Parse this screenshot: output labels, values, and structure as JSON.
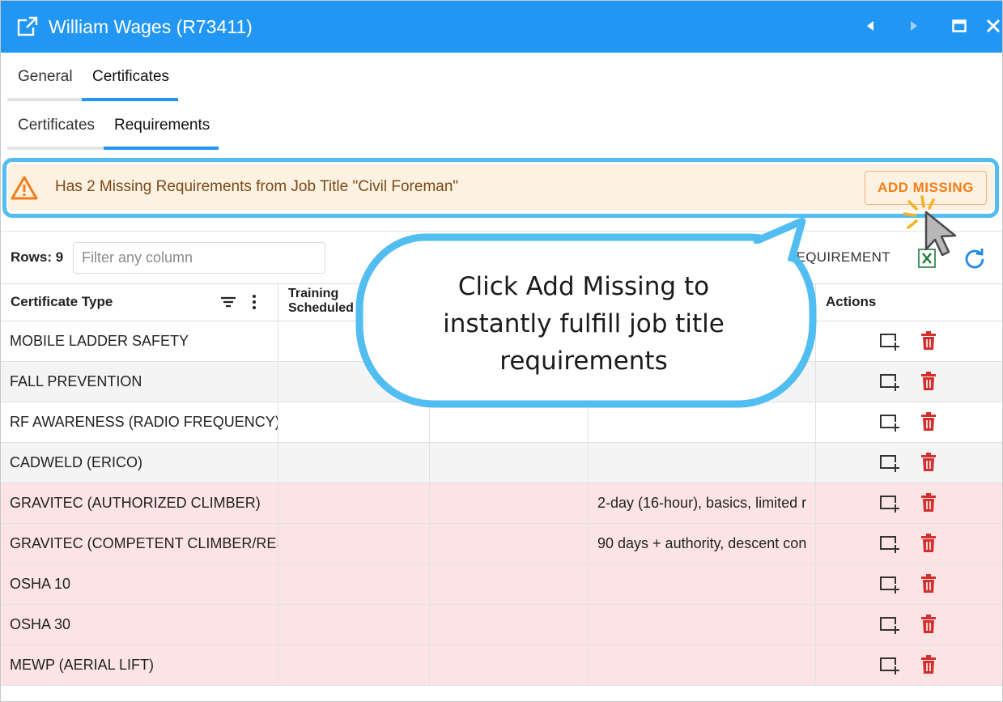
{
  "window": {
    "title": "William Wages (R73411)",
    "controls": [
      "prev-icon",
      "next-icon",
      "maximize-icon",
      "close-icon"
    ]
  },
  "tabs_primary": [
    {
      "label": "General",
      "active": false
    },
    {
      "label": "Certificates",
      "active": true
    }
  ],
  "tabs_secondary": [
    {
      "label": "Certificates",
      "active": false
    },
    {
      "label": "Requirements",
      "active": true
    }
  ],
  "warning": {
    "text": "Has 2 Missing Requirements from Job Title \"Civil Foreman\"",
    "button_label": "ADD MISSING",
    "color": "#ef7f1a"
  },
  "toolbar": {
    "rows_label": "Rows: 9",
    "filter_placeholder": "Filter any column",
    "add_requirement_label": "REQUIREMENT"
  },
  "grid": {
    "columns": [
      {
        "label": "Certificate Type"
      },
      {
        "label": "Training Scheduled"
      },
      {
        "label": ""
      },
      {
        "label": ""
      },
      {
        "label": "Actions"
      }
    ],
    "rows": [
      {
        "type": "MOBILE LADDER SAFETY",
        "notes": "",
        "status": "white"
      },
      {
        "type": "FALL PREVENTION",
        "notes": "",
        "status": "gray"
      },
      {
        "type": "RF AWARENESS (RADIO FREQUENCY)",
        "notes": "",
        "status": "white"
      },
      {
        "type": "CADWELD (ERICO)",
        "notes": "",
        "status": "gray"
      },
      {
        "type": "GRAVITEC (AUTHORIZED CLIMBER)",
        "notes": "2-day (16-hour), basics, limited r",
        "status": "red"
      },
      {
        "type": "GRAVITEC (COMPETENT CLIMBER/RESCUE)",
        "notes": "90 days + authority, descent con",
        "status": "red"
      },
      {
        "type": "OSHA 10",
        "notes": "",
        "status": "red"
      },
      {
        "type": "OSHA 30",
        "notes": "",
        "status": "red"
      },
      {
        "type": "MEWP (AERIAL LIFT)",
        "notes": "",
        "status": "red"
      }
    ]
  },
  "callout": {
    "text_lines": [
      "Click Add Missing to",
      "instantly fulfill job title",
      "requirements"
    ]
  },
  "colors": {
    "titlebar": "#2196f3",
    "accent": "#2196f3",
    "missing_row": "#fde4e4",
    "delete_icon": "#d32f2f",
    "callout_border": "#52bdf0"
  }
}
